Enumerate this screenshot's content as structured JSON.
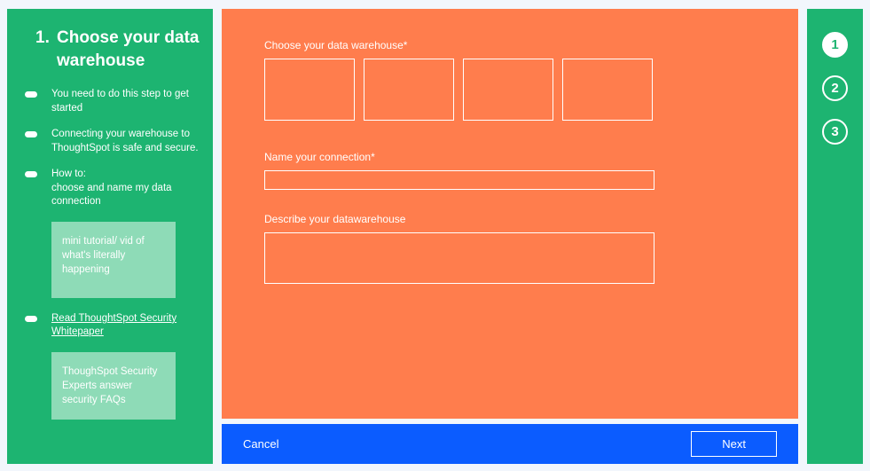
{
  "sidebar": {
    "title_number": "1.",
    "title_text": "Choose your data warehouse",
    "items": [
      {
        "text": "You need to do this step to get started"
      },
      {
        "text": "Connecting your warehouse to ThoughtSpot is safe and secure."
      },
      {
        "text": "How to:\nchoose and name my data connection"
      }
    ],
    "card1": "mini tutorial/ vid of what's literally happening",
    "link_item": "Read ThoughtSpot Security Whitepaper",
    "card2": "ThoughSpot Security Experts answer security FAQs"
  },
  "main": {
    "choose_label": "Choose your data warehouse*",
    "name_label": "Name your connection*",
    "describe_label": "Describe your datawarehouse"
  },
  "footer": {
    "cancel": "Cancel",
    "next": "Next"
  },
  "stepper": {
    "steps": [
      "1",
      "2",
      "3"
    ],
    "active": 0
  }
}
